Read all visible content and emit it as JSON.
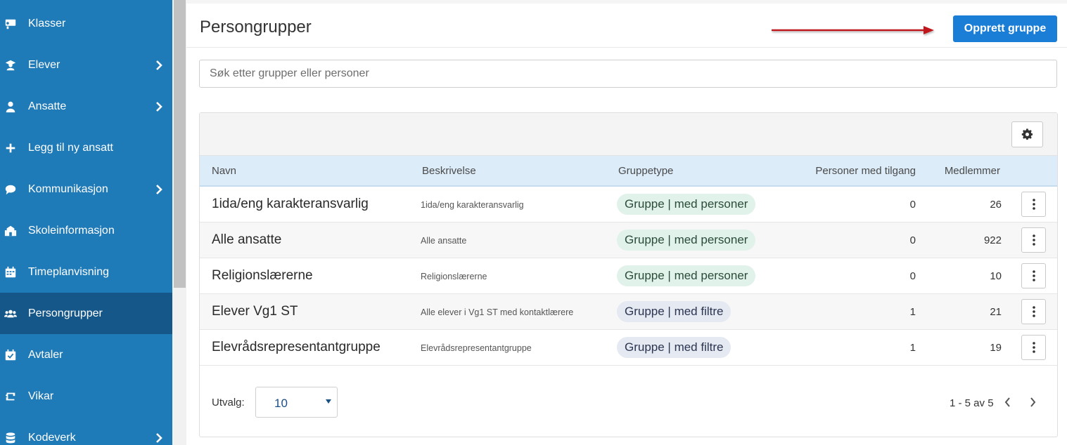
{
  "sidebar": {
    "items": [
      {
        "label": "Klasser",
        "icon": "classroom-icon",
        "has_submenu": false,
        "active": false
      },
      {
        "label": "Elever",
        "icon": "student-icon",
        "has_submenu": true,
        "active": false
      },
      {
        "label": "Ansatte",
        "icon": "user-icon",
        "has_submenu": true,
        "active": false
      },
      {
        "label": "Legg til ny ansatt",
        "icon": "plus-icon",
        "has_submenu": false,
        "active": false
      },
      {
        "label": "Kommunikasjon",
        "icon": "chat-icon",
        "has_submenu": true,
        "active": false
      },
      {
        "label": "Skoleinformasjon",
        "icon": "school-icon",
        "has_submenu": false,
        "active": false
      },
      {
        "label": "Timeplanvisning",
        "icon": "calendar-icon",
        "has_submenu": false,
        "active": false
      },
      {
        "label": "Persongrupper",
        "icon": "users-icon",
        "has_submenu": false,
        "active": true
      },
      {
        "label": "Avtaler",
        "icon": "calendar-check-icon",
        "has_submenu": false,
        "active": false
      },
      {
        "label": "Vikar",
        "icon": "retweet-icon",
        "has_submenu": false,
        "active": false
      },
      {
        "label": "Kodeverk",
        "icon": "database-icon",
        "has_submenu": true,
        "active": false
      }
    ]
  },
  "header": {
    "title": "Persongrupper",
    "create_button": "Opprett gruppe"
  },
  "search": {
    "placeholder": "Søk etter grupper eller personer",
    "value": ""
  },
  "table": {
    "columns": {
      "name": "Navn",
      "description": "Beskrivelse",
      "group_type": "Gruppetype",
      "access": "Personer med tilgang",
      "members": "Medlemmer"
    },
    "rows": [
      {
        "name": "1ida/eng karakteransvarlig",
        "description": "1ida/eng karakteransvarlig",
        "group_type": "Gruppe | med personer",
        "type_kind": "person",
        "access": "0",
        "members": "26"
      },
      {
        "name": "Alle ansatte",
        "description": "Alle ansatte",
        "group_type": "Gruppe | med personer",
        "type_kind": "person",
        "access": "0",
        "members": "922"
      },
      {
        "name": "Religionslærerne",
        "description": "Religionslærerne",
        "group_type": "Gruppe | med personer",
        "type_kind": "person",
        "access": "0",
        "members": "10"
      },
      {
        "name": "Elever Vg1 ST",
        "description": "Alle elever i Vg1 ST med kontaktlærere",
        "group_type": "Gruppe | med filtre",
        "type_kind": "filter",
        "access": "1",
        "members": "21"
      },
      {
        "name": "Elevrådsrepresentantgruppe",
        "description": "Elevrådsrepresentantgruppe",
        "group_type": "Gruppe | med filtre",
        "type_kind": "filter",
        "access": "1",
        "members": "19"
      }
    ]
  },
  "footer": {
    "page_size_label": "Utvalg:",
    "page_size_value": "10",
    "page_info": "1 - 5 av 5"
  },
  "colors": {
    "sidebar_bg": "#1f7ab8",
    "sidebar_active": "#16578a",
    "primary_button": "#1a7ed6",
    "table_header_bg": "#dcecf9",
    "pill_person_bg": "#e0f2ea",
    "pill_filter_bg": "#e5e9f2",
    "annotation_arrow": "#c0161c"
  }
}
